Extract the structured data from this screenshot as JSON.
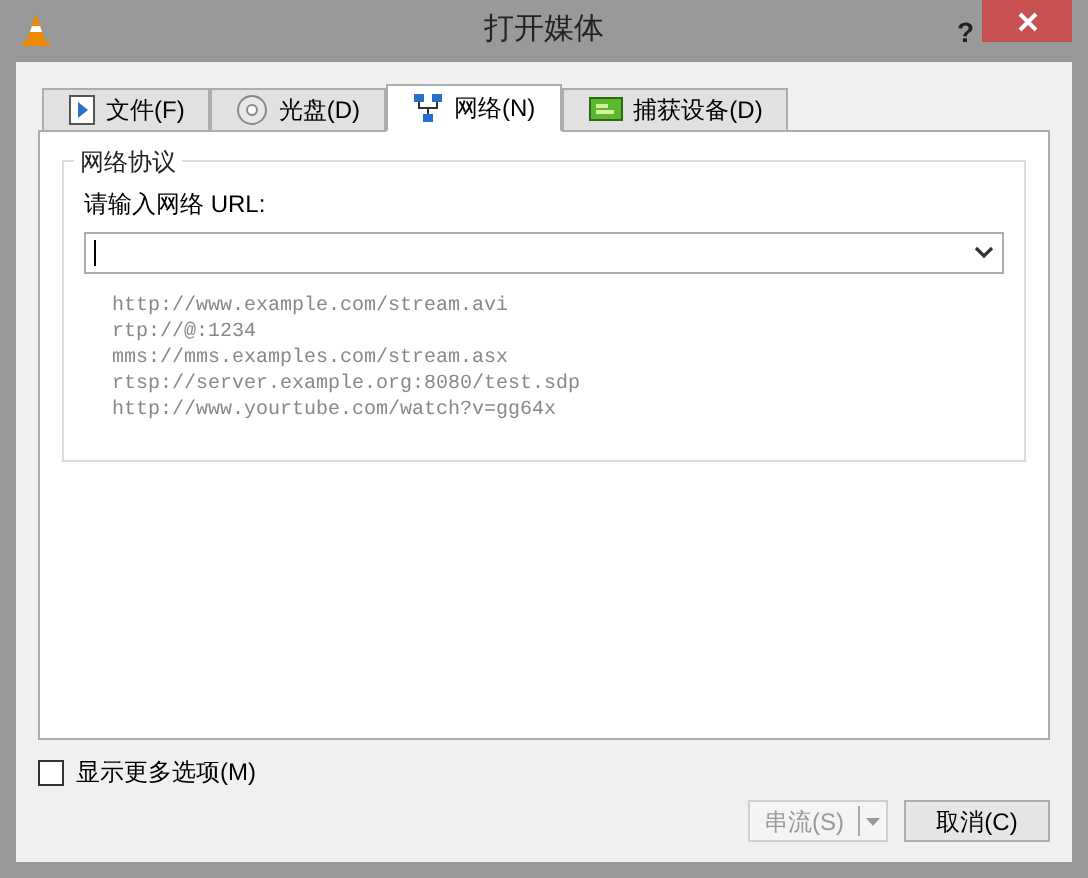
{
  "window": {
    "title": "打开媒体",
    "help": "?"
  },
  "tabs": [
    {
      "label": "文件(F)",
      "kind": "file",
      "selected": false
    },
    {
      "label": "光盘(D)",
      "kind": "disc",
      "selected": false
    },
    {
      "label": "网络(N)",
      "kind": "network",
      "selected": true
    },
    {
      "label": "捕获设备(D)",
      "kind": "capture",
      "selected": false
    }
  ],
  "group": {
    "title": "网络协议",
    "field_label": "请输入网络 URL:",
    "examples": [
      "http://www.example.com/stream.avi",
      "rtp://@:1234",
      "mms://mms.examples.com/stream.asx",
      "rtsp://server.example.org:8080/test.sdp",
      "http://www.yourtube.com/watch?v=gg64x"
    ]
  },
  "more_options": {
    "label": "显示更多选项(M)",
    "checked": false
  },
  "buttons": [
    {
      "label": "串流(S)",
      "kind": "split",
      "disabled": true
    },
    {
      "label": "取消(C)",
      "kind": "plain",
      "disabled": false
    }
  ]
}
